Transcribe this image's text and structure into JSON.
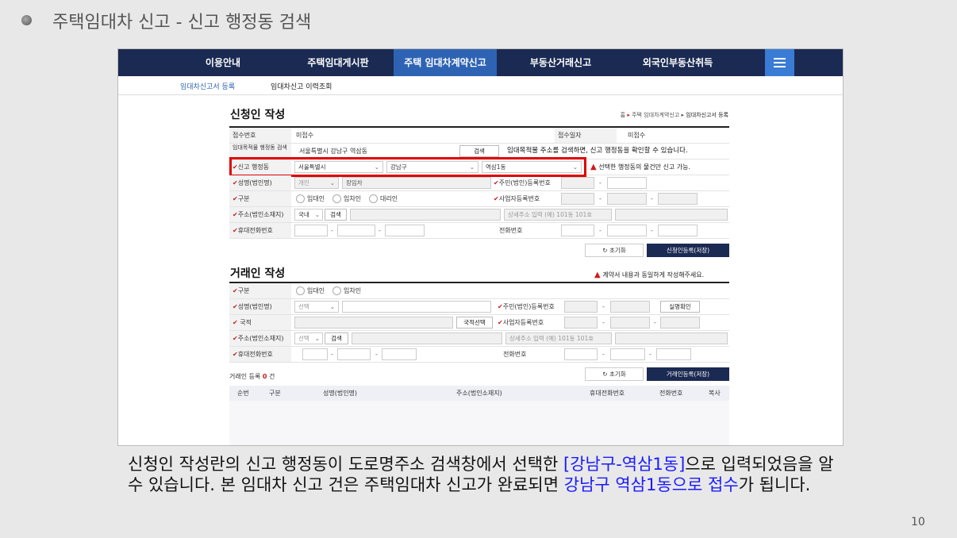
{
  "slide": {
    "title": "주택임대차 신고 - 신고 행정동 검색",
    "caption_pre": "신청인 작성란의 신고 행정동이 도로명주소 검색창에서 선택한 ",
    "caption_blue1": "[강남구-역삼1동]",
    "caption_mid": "으로 입력되었음을 알 수 있습니다. 본 임대차 신고 건은 주택임대차 신고가 완료되면 ",
    "caption_blue2": "강남구 역삼1동으로 접수",
    "caption_post": "가 됩니다.",
    "page_number": "10"
  },
  "topnav": {
    "items": [
      "이용안내",
      "주택임대게시판",
      "주택 임대차계약신고",
      "부동산거래신고",
      "외국인부동산취득"
    ],
    "active_index": 2
  },
  "subnav": {
    "items": [
      "임대차신고서 등록",
      "임대차신고 이력조회"
    ]
  },
  "applicant": {
    "title": "신청인 작성",
    "breadcrumb": [
      "홈",
      "주택 임대차계약신고",
      "임대차신고서 등록"
    ],
    "receipt_no_label": "접수번호",
    "receipt_no_value": "미접수",
    "receipt_date_label": "접수일자",
    "receipt_date_value": "미접수",
    "address_search_label": "임대목적물 행정동 검색",
    "address_value": "서울특별시 강남구 역삼동",
    "search_button": "검색",
    "address_hint": "임대목적물 주소를 검색하면, 신고 행정동을 확인할 수 있습니다.",
    "dong_label": "신고 행정동",
    "sido": "서울특별시",
    "sigungu": "강남구",
    "dong": "역삼1동",
    "dong_warning": "선택한 행정동의 물건만 신고 가능.",
    "name_label": "성명(법인명)",
    "name_type": "개인",
    "name_value": "장임차",
    "resident_no_label": "주민(법인)등록번호",
    "division_label": "구분",
    "division_options": [
      "임대인",
      "임차인",
      "대리인"
    ],
    "business_no_label": "사업자등록번호",
    "address_label": "주소(법인소재지)",
    "domestic": "국내",
    "detail_placeholder": "상세주소 입력 (예) 101동 101호",
    "mobile_label": "휴대전화번호",
    "phone_label": "전화번호",
    "reset_button": "초기화",
    "register_button": "신청인등록(저장)"
  },
  "trader": {
    "title": "거래인 작성",
    "warning": "계약서 내용과 동일하게 작성해주세요.",
    "division_label": "구분",
    "division_options": [
      "임대인",
      "임차인"
    ],
    "name_label": "성명(법인명)",
    "select_label": "선택",
    "resident_no_label": "주민(법인)등록번호",
    "verify_button": "실명확인",
    "nationality_label": "국적",
    "nationality_button": "국적선택",
    "business_no_label": "사업자등록번호",
    "address_label": "주소(법인소재지)",
    "search_button": "검색",
    "detail_placeholder": "상세주소 입력 (예) 101동 101호",
    "mobile_label": "휴대전화번호",
    "phone_label": "전화번호",
    "reset_button": "초기화",
    "register_button": "거래인등록(저장)",
    "count_label": "거래인 등록",
    "count_value": "0",
    "count_unit": "건",
    "table_headers": [
      "순번",
      "구분",
      "성명(법인명)",
      "주소(법인소재지)",
      "휴대전화번호",
      "전화번호",
      "복사"
    ]
  },
  "colors": {
    "nav_bg": "#1b2a52",
    "nav_active": "#2e63b4",
    "highlight": "#e00000",
    "caption_blue": "#1a1aff"
  }
}
